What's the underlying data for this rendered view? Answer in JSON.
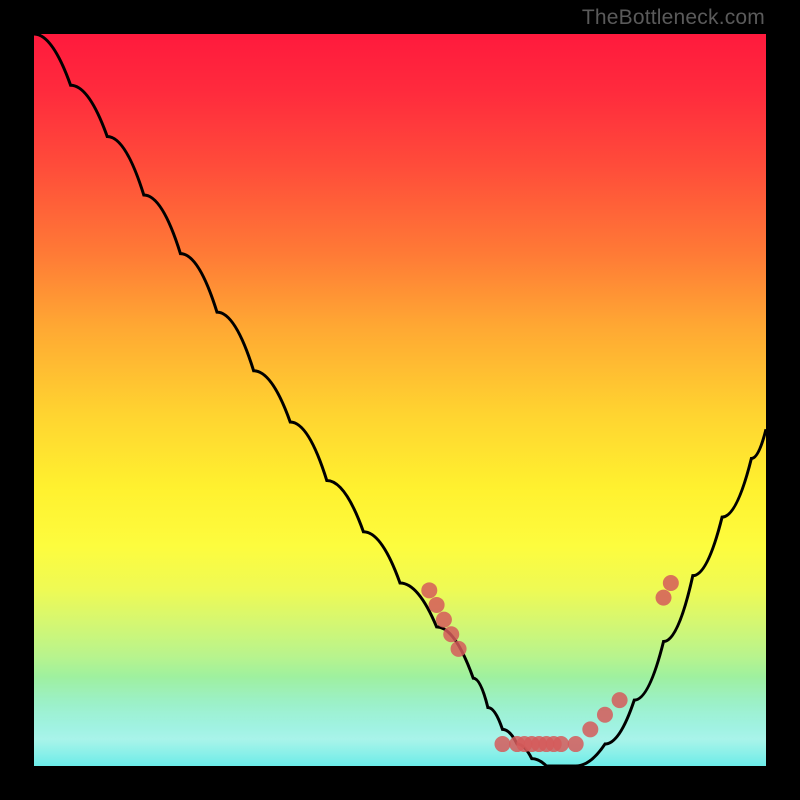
{
  "attribution": "TheBottleneck.com",
  "colors": {
    "gradient_top": "#ff1a3d",
    "gradient_mid": "#fff12f",
    "gradient_bottom": "#1de3de",
    "curve": "#000000",
    "dots": "#d55a5a",
    "bg": "#000000"
  },
  "chart_data": {
    "type": "line",
    "title": "",
    "xlabel": "",
    "ylabel": "",
    "xlim": [
      0,
      100
    ],
    "ylim": [
      0,
      100
    ],
    "series": [
      {
        "name": "bottleneck-curve",
        "x": [
          0,
          5,
          10,
          15,
          20,
          25,
          30,
          35,
          40,
          45,
          50,
          55,
          60,
          62,
          64,
          66,
          68,
          70,
          72,
          74,
          78,
          82,
          86,
          90,
          94,
          98,
          100
        ],
        "y": [
          100,
          93,
          86,
          78,
          70,
          62,
          54,
          47,
          39,
          32,
          25,
          19,
          12,
          8,
          5,
          3,
          1,
          0,
          0,
          0,
          3,
          9,
          17,
          26,
          34,
          42,
          46
        ]
      }
    ],
    "dots": [
      {
        "x": 54,
        "y_pct_from_top": 76
      },
      {
        "x": 55,
        "y_pct_from_top": 78
      },
      {
        "x": 56,
        "y_pct_from_top": 80
      },
      {
        "x": 57,
        "y_pct_from_top": 82
      },
      {
        "x": 58,
        "y_pct_from_top": 84
      },
      {
        "x": 64,
        "y_pct_from_top": 97
      },
      {
        "x": 66,
        "y_pct_from_top": 97
      },
      {
        "x": 67,
        "y_pct_from_top": 97
      },
      {
        "x": 68,
        "y_pct_from_top": 97
      },
      {
        "x": 69,
        "y_pct_from_top": 97
      },
      {
        "x": 70,
        "y_pct_from_top": 97
      },
      {
        "x": 71,
        "y_pct_from_top": 97
      },
      {
        "x": 72,
        "y_pct_from_top": 97
      },
      {
        "x": 74,
        "y_pct_from_top": 97
      },
      {
        "x": 76,
        "y_pct_from_top": 95
      },
      {
        "x": 78,
        "y_pct_from_top": 93
      },
      {
        "x": 80,
        "y_pct_from_top": 91
      },
      {
        "x": 86,
        "y_pct_from_top": 77
      },
      {
        "x": 87,
        "y_pct_from_top": 75
      }
    ]
  }
}
